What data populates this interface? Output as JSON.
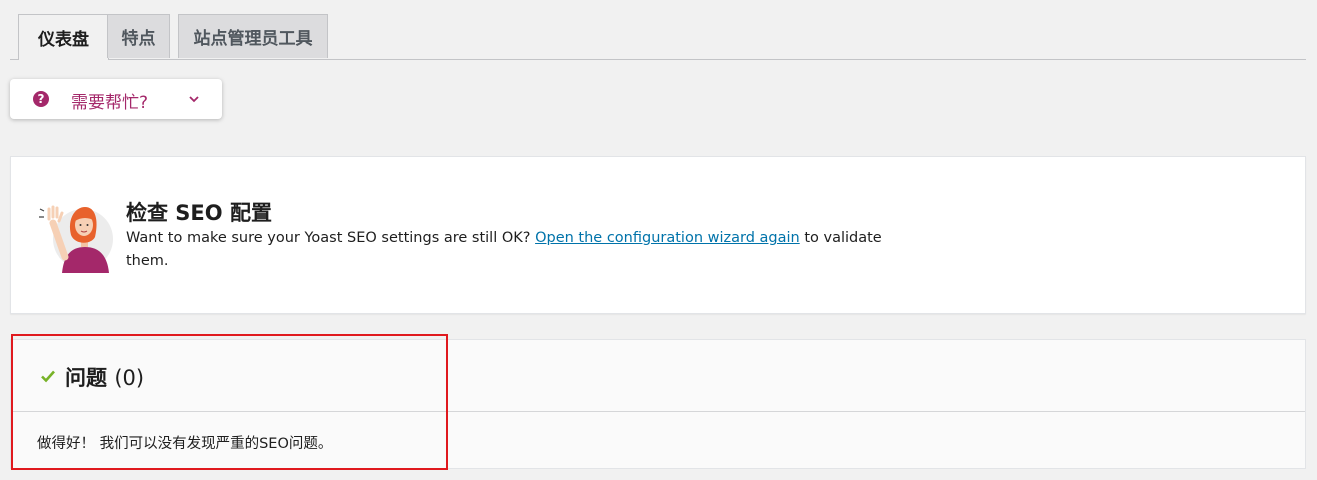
{
  "tabs": [
    {
      "label": "仪表盘",
      "active": true
    },
    {
      "label": "特点",
      "active": false
    },
    {
      "label": "站点管理员工具",
      "active": false
    }
  ],
  "help": {
    "label": "需要帮忙?",
    "icon": "question-circle-icon",
    "chevron": "chevron-down-icon"
  },
  "config": {
    "title": "检查 SEO 配置",
    "text_before": "Want to make sure your Yoast SEO settings are still OK? ",
    "link": "Open the configuration wizard again",
    "text_after": " to validate them."
  },
  "problems": {
    "title": "问题",
    "count": "(0)",
    "message": "做得好！ 我们可以没有发现严重的SEO问题。"
  },
  "colors": {
    "accent": "#a4286a",
    "link": "#0073aa",
    "check": "#77b227",
    "highlight": "#e0191e"
  }
}
